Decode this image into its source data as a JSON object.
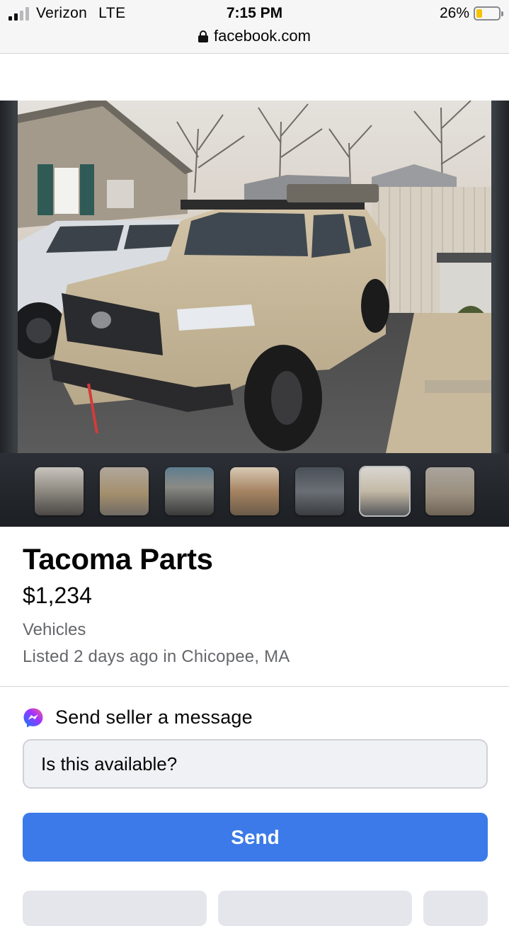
{
  "status_bar": {
    "carrier": "Verizon",
    "network": "LTE",
    "time": "7:15 PM",
    "battery_percent": "26%",
    "battery_level": 0.26,
    "url": "facebook.com"
  },
  "gallery": {
    "thumbnail_count": 7,
    "selected_index": 5
  },
  "listing": {
    "title": "Tacoma Parts",
    "price": "$1,234",
    "category": "Vehicles",
    "listed": "Listed 2 days ago in Chicopee, MA"
  },
  "message": {
    "heading": "Send seller a message",
    "input_value": "Is this available?",
    "send_label": "Send"
  },
  "colors": {
    "send_button": "#3b7ae8",
    "page_background": "#ffffff",
    "secondary_text": "#65676b"
  },
  "icons": {
    "lock": "lock-icon",
    "messenger": "messenger-icon"
  }
}
